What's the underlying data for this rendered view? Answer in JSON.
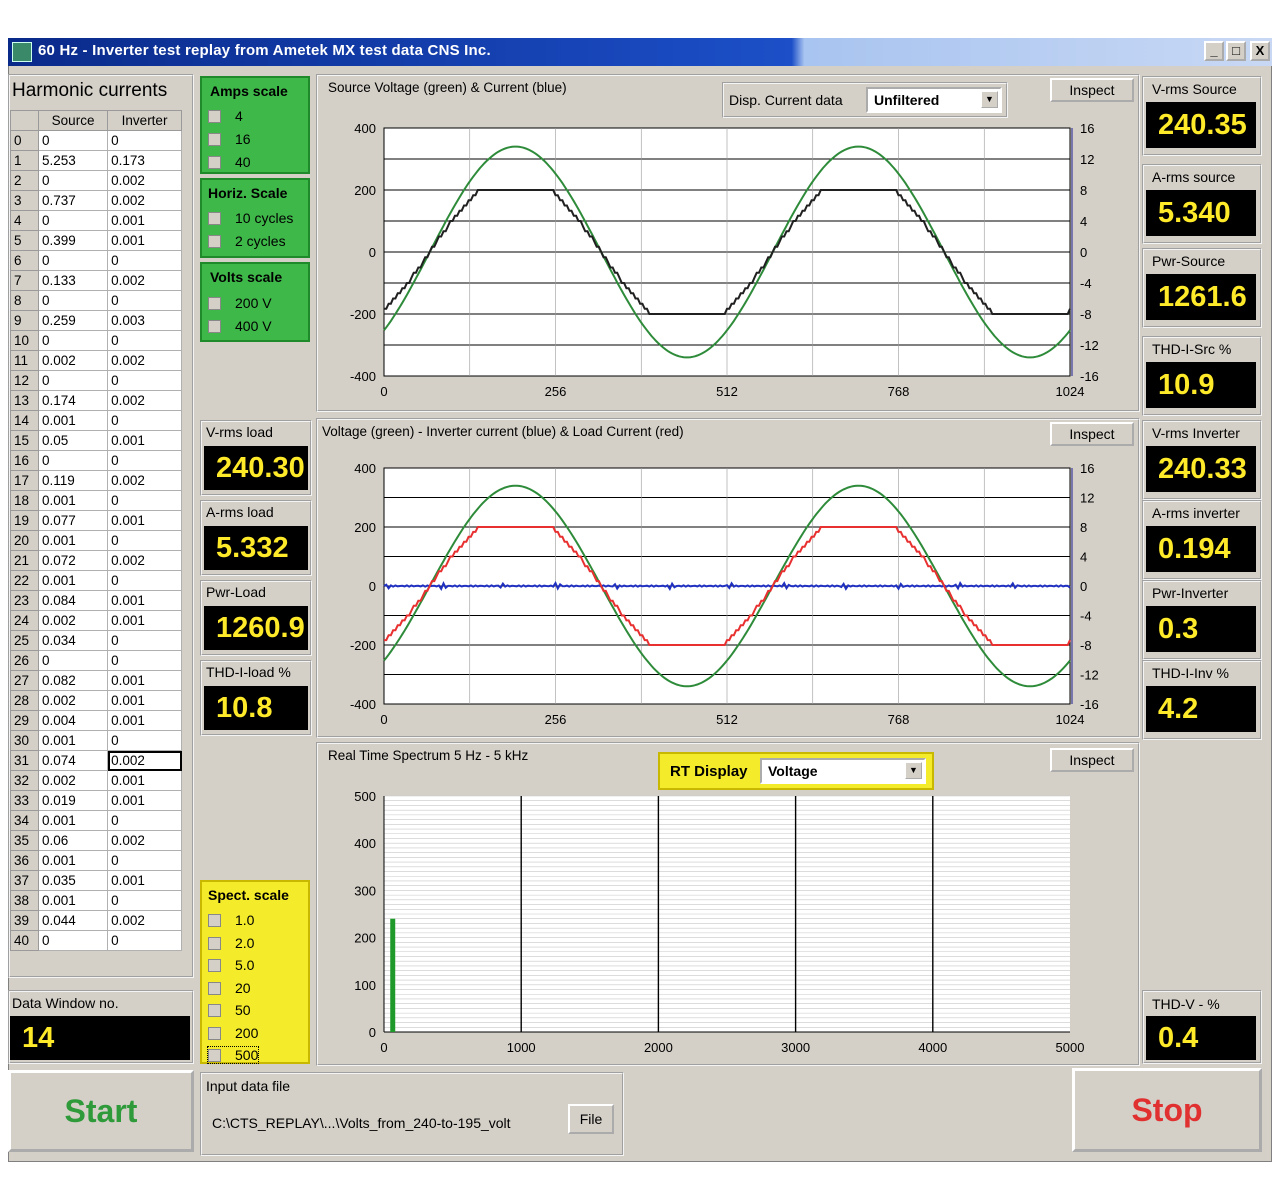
{
  "window": {
    "title": "60 Hz - Inverter test replay from Ametek MX test data   CNS Inc.",
    "buttons": [
      "_",
      "□",
      "X"
    ]
  },
  "harmonics": {
    "title": "Harmonic currents",
    "columns": [
      "Source",
      "Inverter"
    ],
    "rows": [
      [
        "0",
        "0",
        "0"
      ],
      [
        "1",
        "5.253",
        "0.173"
      ],
      [
        "2",
        "0",
        "0.002"
      ],
      [
        "3",
        "0.737",
        "0.002"
      ],
      [
        "4",
        "0",
        "0.001"
      ],
      [
        "5",
        "0.399",
        "0.001"
      ],
      [
        "6",
        "0",
        "0"
      ],
      [
        "7",
        "0.133",
        "0.002"
      ],
      [
        "8",
        "0",
        "0"
      ],
      [
        "9",
        "0.259",
        "0.003"
      ],
      [
        "10",
        "0",
        "0"
      ],
      [
        "11",
        "0.002",
        "0.002"
      ],
      [
        "12",
        "0",
        "0"
      ],
      [
        "13",
        "0.174",
        "0.002"
      ],
      [
        "14",
        "0.001",
        "0"
      ],
      [
        "15",
        "0.05",
        "0.001"
      ],
      [
        "16",
        "0",
        "0"
      ],
      [
        "17",
        "0.119",
        "0.002"
      ],
      [
        "18",
        "0.001",
        "0"
      ],
      [
        "19",
        "0.077",
        "0.001"
      ],
      [
        "20",
        "0.001",
        "0"
      ],
      [
        "21",
        "0.072",
        "0.002"
      ],
      [
        "22",
        "0.001",
        "0"
      ],
      [
        "23",
        "0.084",
        "0.001"
      ],
      [
        "24",
        "0.002",
        "0.001"
      ],
      [
        "25",
        "0.034",
        "0"
      ],
      [
        "26",
        "0",
        "0"
      ],
      [
        "27",
        "0.082",
        "0.001"
      ],
      [
        "28",
        "0.002",
        "0.001"
      ],
      [
        "29",
        "0.004",
        "0.001"
      ],
      [
        "30",
        "0.001",
        "0"
      ],
      [
        "31",
        "0.074",
        "0.002"
      ],
      [
        "32",
        "0.002",
        "0.001"
      ],
      [
        "33",
        "0.019",
        "0.001"
      ],
      [
        "34",
        "0.001",
        "0"
      ],
      [
        "35",
        "0.06",
        "0.002"
      ],
      [
        "36",
        "0.001",
        "0"
      ],
      [
        "37",
        "0.035",
        "0.001"
      ],
      [
        "38",
        "0.001",
        "0"
      ],
      [
        "39",
        "0.044",
        "0.002"
      ],
      [
        "40",
        "0",
        "0"
      ]
    ]
  },
  "data_window": {
    "label": "Data Window no.",
    "value": "14"
  },
  "amps_scale": {
    "title": "Amps scale",
    "options": [
      "4",
      "16",
      "40"
    ]
  },
  "horiz_scale": {
    "title": "Horiz. Scale",
    "options": [
      "10 cycles",
      "2 cycles"
    ]
  },
  "volts_scale": {
    "title": "Volts scale",
    "options": [
      "200 V",
      "400 V"
    ]
  },
  "spect_scale": {
    "title": "Spect. scale",
    "options": [
      "1.0",
      "2.0",
      "5.0",
      "20",
      "50",
      "200",
      "500"
    ]
  },
  "load_readouts": [
    {
      "label": "V-rms load",
      "value": "240.30"
    },
    {
      "label": "A-rms load",
      "value": "5.332"
    },
    {
      "label": "Pwr-Load",
      "value": "1260.9"
    },
    {
      "label": "THD-I-load  %",
      "value": "10.8"
    }
  ],
  "right_readouts": [
    {
      "label": "V-rms Source",
      "value": "240.35"
    },
    {
      "label": "A-rms source",
      "value": "5.340"
    },
    {
      "label": "Pwr-Source",
      "value": "1261.6"
    },
    {
      "label": "THD-I-Src  %",
      "value": "10.9"
    },
    {
      "label": "V-rms Inverter",
      "value": "240.33"
    },
    {
      "label": "A-rms inverter",
      "value": "0.194"
    },
    {
      "label": "Pwr-Inverter",
      "value": "0.3"
    },
    {
      "label": "THD-I-Inv  %",
      "value": "4.2"
    }
  ],
  "thd_v": {
    "label": "THD-V - %",
    "value": "0.4"
  },
  "chart1": {
    "title": "Source Voltage (green) & Current (blue)",
    "disp_label": "Disp. Current data",
    "disp_value": "Unfiltered",
    "inspect": "Inspect",
    "left_ticks": [
      "400",
      "200",
      "0",
      "-200",
      "-400"
    ],
    "right_ticks": [
      "16",
      "12",
      "8",
      "4",
      "0",
      "-4",
      "-8",
      "-12",
      "-16"
    ],
    "x_ticks": [
      "0",
      "256",
      "512",
      "768",
      "1024"
    ]
  },
  "chart2": {
    "title": "Voltage (green) - Inverter current (blue) & Load Current (red)",
    "inspect": "Inspect",
    "left_ticks": [
      "400",
      "200",
      "0",
      "-200",
      "-400"
    ],
    "right_ticks": [
      "16",
      "12",
      "8",
      "4",
      "0",
      "-4",
      "-8",
      "-12",
      "-16"
    ],
    "x_ticks": [
      "0",
      "256",
      "512",
      "768",
      "1024"
    ]
  },
  "chart3": {
    "title": "Real Time Spectrum  5 Hz - 5 kHz",
    "rt_label": "RT Display",
    "rt_value": "Voltage",
    "inspect": "Inspect",
    "y_ticks": [
      "500",
      "400",
      "300",
      "200",
      "100",
      "0"
    ],
    "x_ticks": [
      "0",
      "1000",
      "2000",
      "3000",
      "4000",
      "5000"
    ]
  },
  "input_file": {
    "label": "Input data file",
    "path": "C:\\CTS_REPLAY\\...\\Volts_from_240-to-195_volt",
    "file_button": "File"
  },
  "start_label": "Start",
  "stop_label": "Stop",
  "colors": {
    "voltage": "#2e8b3a",
    "current": "#202020",
    "inverter": "#2030c0",
    "load": "#e83030",
    "spectrum": "#1f9a2a",
    "readout_text": "#ffea2a"
  },
  "chart_data": [
    {
      "type": "line",
      "title": "Source Voltage (green) & Current (blue)",
      "x": [
        0,
        256,
        512,
        768,
        1024
      ],
      "xlim": [
        0,
        1024
      ],
      "ylim_left": [
        -400,
        400
      ],
      "ylim_right": [
        -16,
        16
      ],
      "series": [
        {
          "name": "Source Voltage",
          "axis": "left",
          "values": [
            -250,
            340,
            -340,
            340,
            -250
          ],
          "shape": "sine",
          "amplitude": 340,
          "cycles": 2,
          "phase_deg": -48
        },
        {
          "name": "Source Current",
          "axis": "right",
          "values": [
            -5,
            8,
            -8,
            8,
            -5
          ],
          "shape": "flattened-sine",
          "amplitude": 8,
          "cycles": 2,
          "phase_deg": -48
        }
      ]
    },
    {
      "type": "line",
      "title": "Voltage (green) - Inverter current (blue) & Load Current (red)",
      "x": [
        0,
        256,
        512,
        768,
        1024
      ],
      "xlim": [
        0,
        1024
      ],
      "ylim_left": [
        -400,
        400
      ],
      "ylim_right": [
        -16,
        16
      ],
      "series": [
        {
          "name": "Voltage",
          "axis": "left",
          "values": [
            -250,
            340,
            -340,
            340,
            -250
          ],
          "shape": "sine",
          "amplitude": 340,
          "cycles": 2,
          "phase_deg": -48
        },
        {
          "name": "Inverter current",
          "axis": "right",
          "values": [
            0,
            0,
            0,
            0,
            0
          ],
          "shape": "noise",
          "amplitude": 0.2
        },
        {
          "name": "Load Current",
          "axis": "right",
          "values": [
            -5,
            8,
            -8,
            8,
            -5
          ],
          "shape": "flattened-sine",
          "amplitude": 8,
          "cycles": 2,
          "phase_deg": -48
        }
      ]
    },
    {
      "type": "bar",
      "title": "Real Time Spectrum  5 Hz - 5 kHz",
      "xlim": [
        0,
        5000
      ],
      "ylim": [
        0,
        500
      ],
      "x": [
        60
      ],
      "values": [
        240
      ]
    }
  ]
}
